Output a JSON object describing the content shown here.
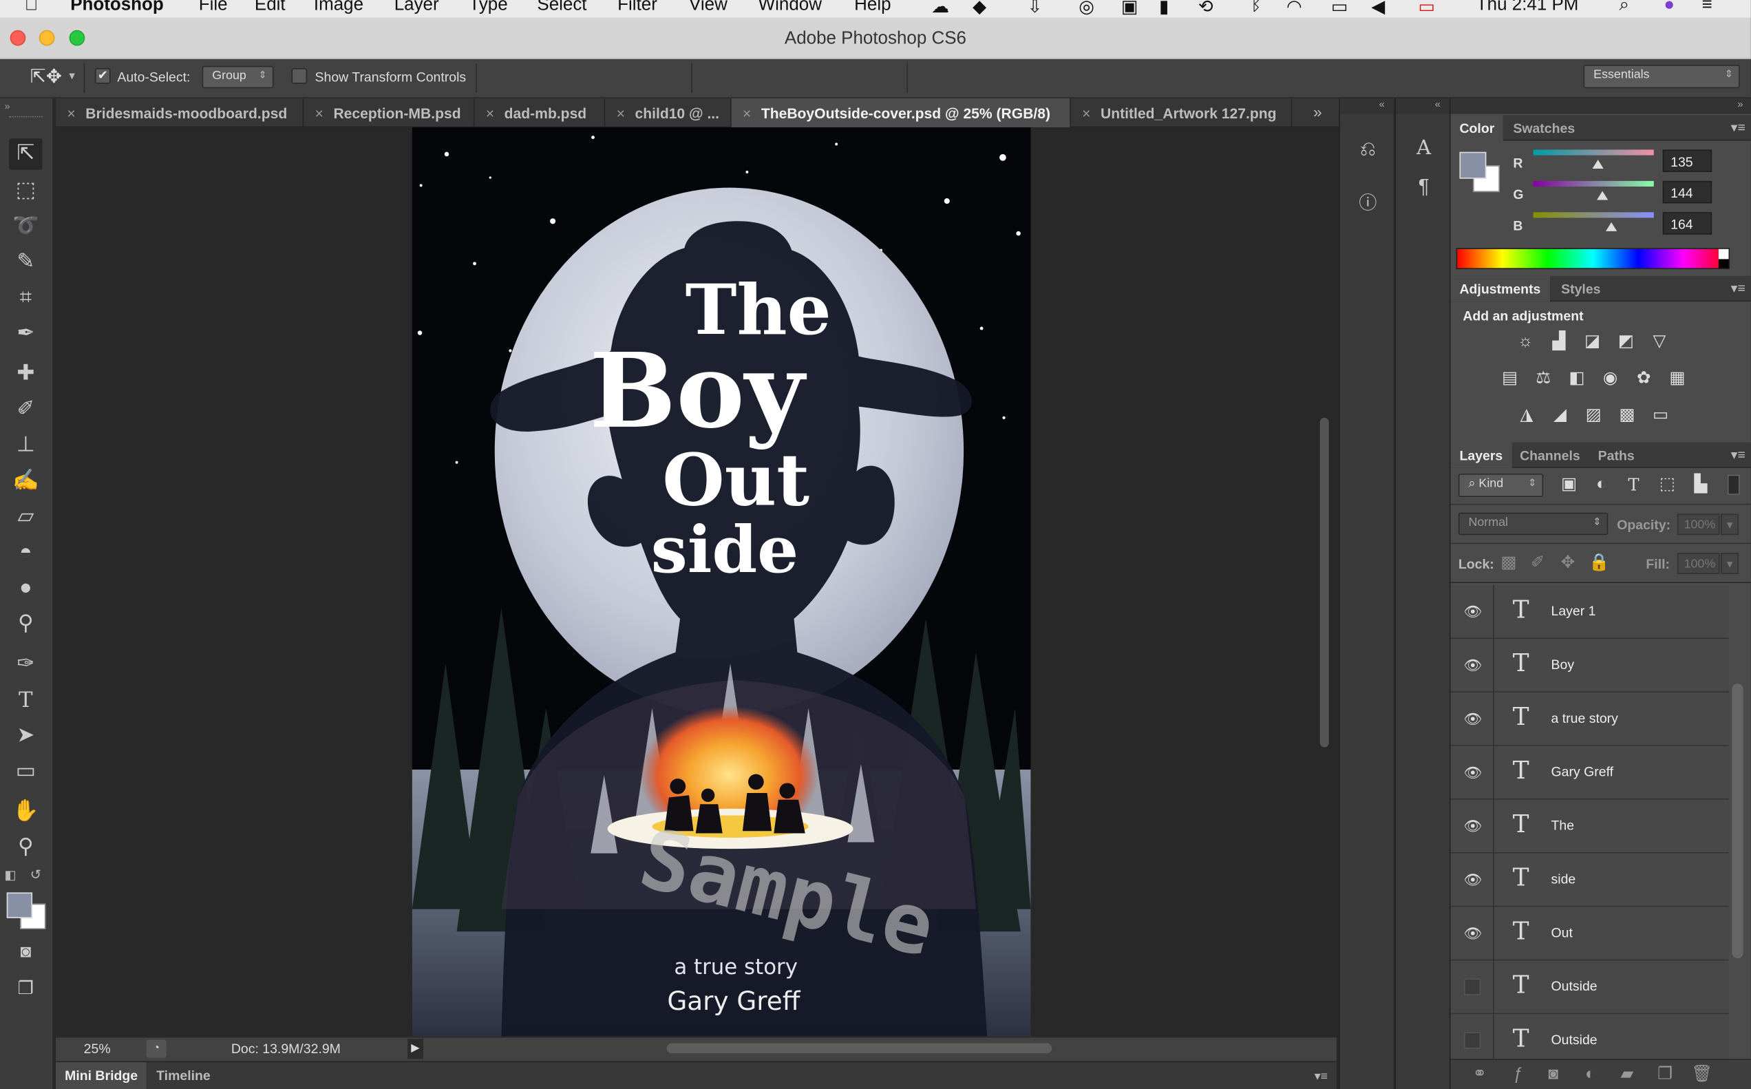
{
  "mac_menubar": {
    "app_name": "Photoshop",
    "items": [
      "File",
      "Edit",
      "Image",
      "Layer",
      "Type",
      "Select",
      "Filter",
      "View",
      "Window",
      "Help"
    ],
    "clock": "Thu 2:41 PM"
  },
  "window": {
    "title": "Adobe Photoshop CS6"
  },
  "options_bar": {
    "auto_select_label": "Auto-Select:",
    "auto_select_value": "Group",
    "transform_label": "Show Transform Controls",
    "workspace": "Essentials"
  },
  "doc_tabs": [
    {
      "label": "Bridesmaids-moodboard.psd",
      "x": "×"
    },
    {
      "label": "Reception-MB.psd",
      "x": "×"
    },
    {
      "label": "dad-mb.psd",
      "x": "×"
    },
    {
      "label": "child10 @ ...",
      "x": "×"
    },
    {
      "label": "TheBoyOutside-cover.psd @ 25% (RGB/8)",
      "x": "×"
    },
    {
      "label": "Untitled_Artwork 127.png",
      "x": "×"
    }
  ],
  "artwork": {
    "title_the": "The",
    "title_boy": "Boy",
    "title_out": "Out",
    "title_side": "side",
    "watermark": "Sample",
    "subtitle": "a true story",
    "author": "Gary Greff"
  },
  "status_bar": {
    "zoom": "25%",
    "doc_info": "Doc: 13.9M/32.9M"
  },
  "bottom_tabs": [
    "Mini Bridge",
    "Timeline"
  ],
  "color_panel": {
    "tabs": [
      "Color",
      "Swatches"
    ],
    "r_label": "R",
    "g_label": "G",
    "b_label": "B",
    "r": 135,
    "g": 144,
    "b": 164,
    "foreground_hex": "#8790a4"
  },
  "adjustments_panel": {
    "tabs": [
      "Adjustments",
      "Styles"
    ],
    "heading": "Add an adjustment"
  },
  "layers_panel": {
    "tabs": [
      "Layers",
      "Channels",
      "Paths"
    ],
    "filter_kind": "Kind",
    "blend_mode": "Normal",
    "opacity_label": "Opacity:",
    "opacity_value": "100%",
    "lock_label": "Lock:",
    "fill_label": "Fill:",
    "fill_value": "100%",
    "layers": [
      {
        "name": "Layer 1",
        "visible": true
      },
      {
        "name": "Boy",
        "visible": true
      },
      {
        "name": "a true story",
        "visible": true
      },
      {
        "name": "Gary Greff",
        "visible": true
      },
      {
        "name": "The",
        "visible": true
      },
      {
        "name": "side",
        "visible": true
      },
      {
        "name": "Out",
        "visible": true
      },
      {
        "name": "Outside",
        "visible": false
      },
      {
        "name": "Outside",
        "visible": false
      }
    ]
  },
  "colors": {
    "accent_fg": "#8790a4",
    "ui_bg": "#4b4b4b"
  }
}
